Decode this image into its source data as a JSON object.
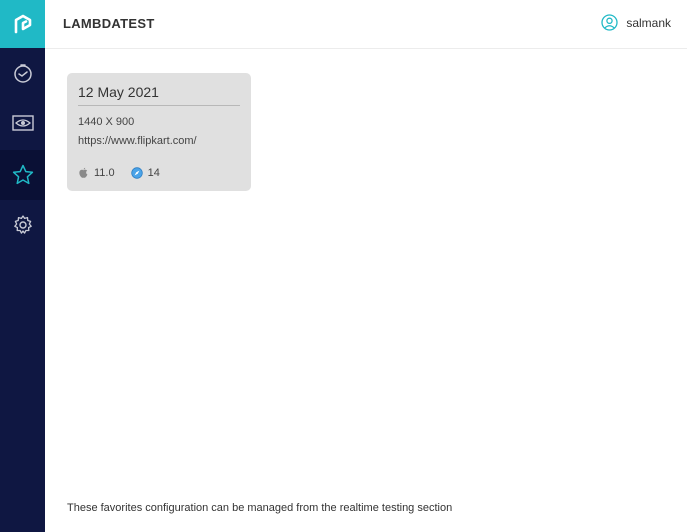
{
  "header": {
    "brand": "LAMBDATEST",
    "username": "salmank"
  },
  "sidebar": {
    "items": [
      {
        "name": "realtime",
        "icon": "stopwatch-icon"
      },
      {
        "name": "visual",
        "icon": "eye-screen-icon"
      },
      {
        "name": "favorites",
        "icon": "star-icon",
        "active": true
      },
      {
        "name": "settings",
        "icon": "gear-icon"
      }
    ]
  },
  "favorite": {
    "date": "12 May 2021",
    "resolution": "1440 X 900",
    "url": "https://www.flipkart.com/",
    "os_version": "11.0",
    "browser_version": "14"
  },
  "footer": {
    "note": "These favorites configuration can be managed from the realtime testing section"
  },
  "colors": {
    "sidebar": "#0f1742",
    "accent": "#20b9c6",
    "card": "#e0e0e0"
  }
}
